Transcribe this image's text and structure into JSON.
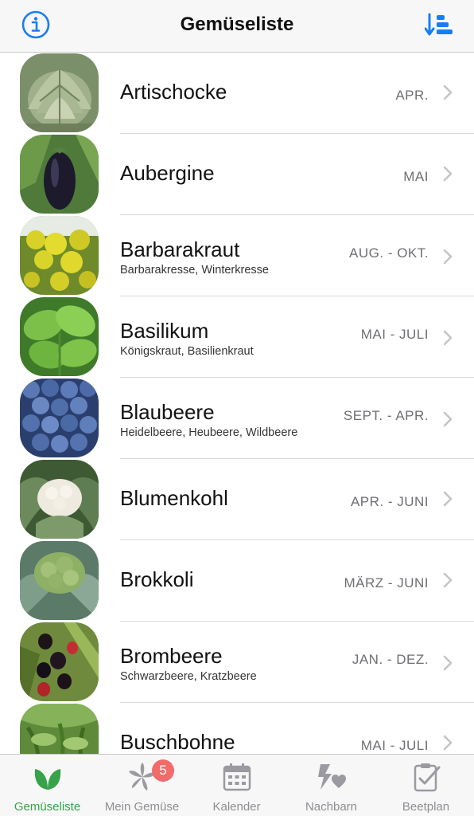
{
  "header": {
    "title": "Gemüseliste",
    "info_icon": "info-circle-icon",
    "sort_icon": "sort-list-icon",
    "accent_color": "#1a7cf5"
  },
  "vegetables": [
    {
      "name": "Artischocke",
      "synonyms": "",
      "season": "APR.",
      "image": "artichoke-photo"
    },
    {
      "name": "Aubergine",
      "synonyms": "",
      "season": "MAI",
      "image": "eggplant-photo"
    },
    {
      "name": "Barbarakraut",
      "synonyms": "Barbarakresse, Winterkresse",
      "season": "AUG. - OKT.",
      "image": "barbarakraut-photo"
    },
    {
      "name": "Basilikum",
      "synonyms": "Königskraut, Basilienkraut",
      "season": "MAI - JULI",
      "image": "basil-photo"
    },
    {
      "name": "Blaubeere",
      "synonyms": "Heidelbeere, Heubeere, Wildbeere",
      "season": "SEPT. - APR.",
      "image": "blueberry-photo"
    },
    {
      "name": "Blumenkohl",
      "synonyms": "",
      "season": "APR. - JUNI",
      "image": "cauliflower-photo"
    },
    {
      "name": "Brokkoli",
      "synonyms": "",
      "season": "MÄRZ - JUNI",
      "image": "broccoli-photo"
    },
    {
      "name": "Brombeere",
      "synonyms": "Schwarzbeere, Kratzbeere",
      "season": "JAN. - DEZ.",
      "image": "blackberry-photo"
    },
    {
      "name": "Buschbohne",
      "synonyms": "",
      "season": "MAI - JULI",
      "image": "bush-bean-photo"
    }
  ],
  "tabbar": {
    "active_color": "#37a24a",
    "tabs": [
      {
        "label": "Gemüseliste",
        "icon": "sprout-icon",
        "active": true
      },
      {
        "label": "Mein Gemüse",
        "icon": "star-leaf-icon",
        "badge": "5"
      },
      {
        "label": "Kalender",
        "icon": "calendar-icon"
      },
      {
        "label": "Nachbarn",
        "icon": "neighbors-icon"
      },
      {
        "label": "Beetplan",
        "icon": "clipboard-check-icon"
      }
    ]
  }
}
